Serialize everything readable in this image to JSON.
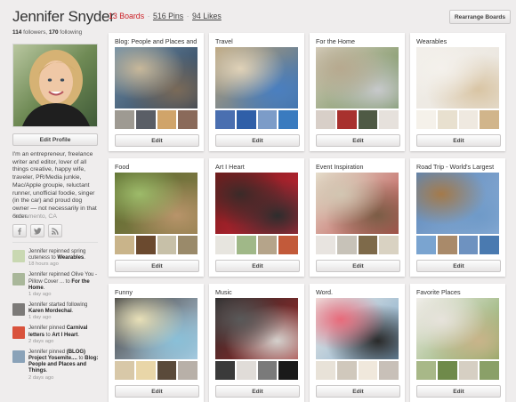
{
  "profile": {
    "name": "Jennifer Snyder",
    "followers": "114",
    "followers_label": " followers, ",
    "following": "170",
    "following_label": " following",
    "edit_label": "Edit Profile",
    "bio": "I'm an entrepreneur, freelance writer and editor, lover of all things creative, happy wife, traveler, PR/Media junkie, Mac/Apple groupie, reluctant runner, unofficial foodie, singer (in the car) and proud dog owner — not necessarily in that order.",
    "location": "Sacramento, CA"
  },
  "social_icons": [
    "facebook-icon",
    "twitter-icon",
    "rss-icon"
  ],
  "activity": [
    {
      "pre": "Jennifer repinned spring cuteness to ",
      "target": "Wearables",
      "post": ".",
      "time": "18 hours ago",
      "thumb": "#c9d8b2"
    },
    {
      "pre": "Jennifer repinned Olive You - Pillow Cover ... to ",
      "target": "For the Home",
      "post": ".",
      "time": "1 day ago",
      "thumb": "#a9b79a"
    },
    {
      "pre": "Jennifer started following ",
      "target": "Karen Mordechai",
      "post": ".",
      "time": "1 day ago",
      "thumb": "#7c7a78"
    },
    {
      "pre": "Jennifer pinned ",
      "target": "Carnival letters",
      "mid": " to ",
      "target2": "Art I Heart",
      "post": ".",
      "time": "2 days ago",
      "thumb": "#d9523c"
    },
    {
      "pre": "Jennifer pinned ",
      "target": "(BLOG) Project Yosemite....",
      "mid": " to ",
      "target2": "Blog: People and Places and Things",
      "post": ".",
      "time": "2 days ago",
      "thumb": "#8aa2b8"
    }
  ],
  "header": {
    "boards": "13 Boards",
    "pins": "516 Pins",
    "likes": "94 Likes",
    "separator": "·",
    "rearrange_label": "Rearrange Boards"
  },
  "boards": [
    {
      "title": "Blog: People and Places and",
      "edit": "Edit",
      "cover": [
        "#6e8fa8",
        "#2a3b52",
        "#c8b89a",
        "#7a6a58"
      ],
      "smalls": [
        "#9e9a92",
        "#5a5e66",
        "#d0a46a",
        "#8a6a5a"
      ]
    },
    {
      "title": "Travel",
      "edit": "Edit",
      "cover": [
        "#b9a27a",
        "#3d6fa6",
        "#e0d2b8",
        "#4a7fc0"
      ],
      "smalls": [
        "#4a6fb0",
        "#2f5fa8",
        "#7c9cc8",
        "#3a7bbf"
      ]
    },
    {
      "title": "For the Home",
      "edit": "Edit",
      "cover": [
        "#d8d0c0",
        "#6a8a54",
        "#b7a98f",
        "#c7c9cb"
      ],
      "smalls": [
        "#d8cfc8",
        "#a8312e",
        "#4f5a45",
        "#e6e1dc"
      ]
    },
    {
      "title": "Wearables",
      "edit": "Edit",
      "cover": [
        "#f2efea",
        "#e9e4dc",
        "#f4f1ec",
        "#d9c5a4"
      ],
      "smalls": [
        "#f5f1ea",
        "#e8e0cf",
        "#efe9e0",
        "#d1b58b"
      ]
    },
    {
      "title": "Food",
      "edit": "Edit",
      "cover": [
        "#5a6b2e",
        "#8c7b4a",
        "#9dbb6a",
        "#b8946a"
      ],
      "smalls": [
        "#c9b48a",
        "#6b4a2f",
        "#c7c0a8",
        "#9a8a6a"
      ]
    },
    {
      "title": "Art I Heart",
      "edit": "Edit",
      "cover": [
        "#7a1a1a",
        "#c9283a",
        "#3a2a28",
        "#2d2d2d"
      ],
      "smalls": [
        "#e7e5df",
        "#a0b888",
        "#b5a48a",
        "#c25a3a"
      ]
    },
    {
      "title": "Event Inspiration",
      "edit": "Edit",
      "cover": [
        "#e9e2d0",
        "#b84a4a",
        "#d2c6b2",
        "#7b5d46"
      ],
      "smalls": [
        "#e8e4e0",
        "#c7c2b8",
        "#7e6a4a",
        "#d9d2c2"
      ]
    },
    {
      "title": "Road Trip - World's Largest",
      "edit": "Edit",
      "cover": [
        "#5a86b8",
        "#8fb0d8",
        "#a47a4a",
        "#6f9ac8"
      ],
      "smalls": [
        "#7aa4d0",
        "#a98a6a",
        "#6e92c0",
        "#4a7ab0"
      ]
    },
    {
      "title": "Funny",
      "edit": "Edit",
      "cover": [
        "#3a3a3a",
        "#b9d2e6",
        "#e8e0b8",
        "#8ac0d8"
      ],
      "smalls": [
        "#d8c8a8",
        "#e9d6a8",
        "#5a4a3a",
        "#b8b0a8"
      ]
    },
    {
      "title": "Music",
      "edit": "Edit",
      "cover": [
        "#2a2a2a",
        "#a32a2a",
        "#595959",
        "#d4d0cc"
      ],
      "smalls": [
        "#3a3a3a",
        "#e0dcd8",
        "#7a7a7a",
        "#1a1a1a"
      ]
    },
    {
      "title": "Word.",
      "edit": "Edit",
      "cover": [
        "#f2eee8",
        "#7aa6c8",
        "#e86a7a",
        "#2a2a2a"
      ],
      "smalls": [
        "#e8e2d8",
        "#d0c8bc",
        "#f0e8dc",
        "#c8c0b8"
      ]
    },
    {
      "title": "Favorite Places",
      "edit": "Edit",
      "cover": [
        "#f2f0ec",
        "#7ea258",
        "#e7e3dc",
        "#c9b48a"
      ],
      "smalls": [
        "#a8b888",
        "#6f8a4a",
        "#d6cfc3",
        "#8aa068"
      ]
    }
  ]
}
